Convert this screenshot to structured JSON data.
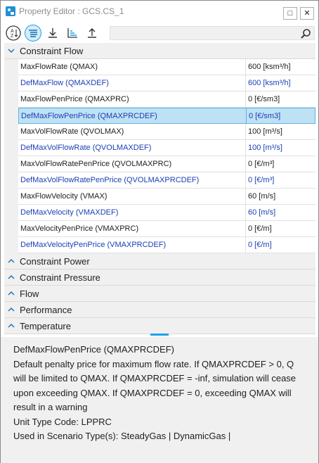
{
  "window": {
    "title": "Property Editor : GCS.CS_1"
  },
  "title_buttons": {
    "restore": "□",
    "close": "✕"
  },
  "search": {
    "placeholder": ""
  },
  "categories": [
    {
      "label": "Constraint Flow",
      "expanded": true
    },
    {
      "label": "Constraint Power",
      "expanded": false
    },
    {
      "label": "Constraint Pressure",
      "expanded": false
    },
    {
      "label": "Flow",
      "expanded": false
    },
    {
      "label": "Performance",
      "expanded": false
    },
    {
      "label": "Temperature",
      "expanded": false
    }
  ],
  "rows": [
    {
      "name": "MaxFlowRate (QMAX)",
      "value": "600 [ksm³/h]",
      "default": false
    },
    {
      "name": "DefMaxFlow (QMAXDEF)",
      "value": "600 [ksm³/h]",
      "default": true
    },
    {
      "name": "MaxFlowPenPrice (QMAXPRC)",
      "value": "0 [€/sm3]",
      "default": false
    },
    {
      "name": "DefMaxFlowPenPrice (QMAXPRCDEF)",
      "value": "0 [€/sm3]",
      "default": true,
      "selected": true
    },
    {
      "name": "MaxVolFlowRate (QVOLMAX)",
      "value": "100 [m³/s]",
      "default": false
    },
    {
      "name": "DefMaxVolFlowRate (QVOLMAXDEF)",
      "value": "100 [m³/s]",
      "default": true
    },
    {
      "name": "MaxVolFlowRatePenPrice (QVOLMAXPRC)",
      "value": "0 [€/m³]",
      "default": false
    },
    {
      "name": "DefMaxVolFlowRatePenPrice (QVOLMAXPRCDEF)",
      "value": "0 [€/m³]",
      "default": true
    },
    {
      "name": "MaxFlowVelocity (VMAX)",
      "value": "60 [m/s]",
      "default": false
    },
    {
      "name": "DefMaxVelocity (VMAXDEF)",
      "value": "60 [m/s]",
      "default": true
    },
    {
      "name": "MaxVelocityPenPrice (VMAXPRC)",
      "value": "0 [€/m]",
      "default": false
    },
    {
      "name": "DefMaxVelocityPenPrice (VMAXPRCDEF)",
      "value": "0 [€/m]",
      "default": true
    }
  ],
  "description": {
    "title": "DefMaxFlowPenPrice (QMAXPRCDEF)",
    "body": "Default penalty price for maximum flow rate. If QMAXPRCDEF > 0, Q will be limited to QMAX. If QMAXPRCDEF = -inf, simulation will cease upon exceeding QMAX. If QMAXPRCDEF = 0, exceeding QMAX will result in a warning",
    "unit_type": "Unit Type Code: LPPRC",
    "scenarios": "Used in Scenario Type(s): SteadyGas | DynamicGas |"
  },
  "colors": {
    "accent": "#1da1e8",
    "default_value": "#1a3fb5",
    "selected_row": "#bfe1f4",
    "category_bg": "#f0f0f0"
  },
  "icons": [
    "app-icon",
    "sort-alpha-icon",
    "categorized-icon",
    "import-icon",
    "sort-icon",
    "export-icon",
    "search-icon",
    "chevron-down-icon",
    "chevron-up-icon"
  ]
}
